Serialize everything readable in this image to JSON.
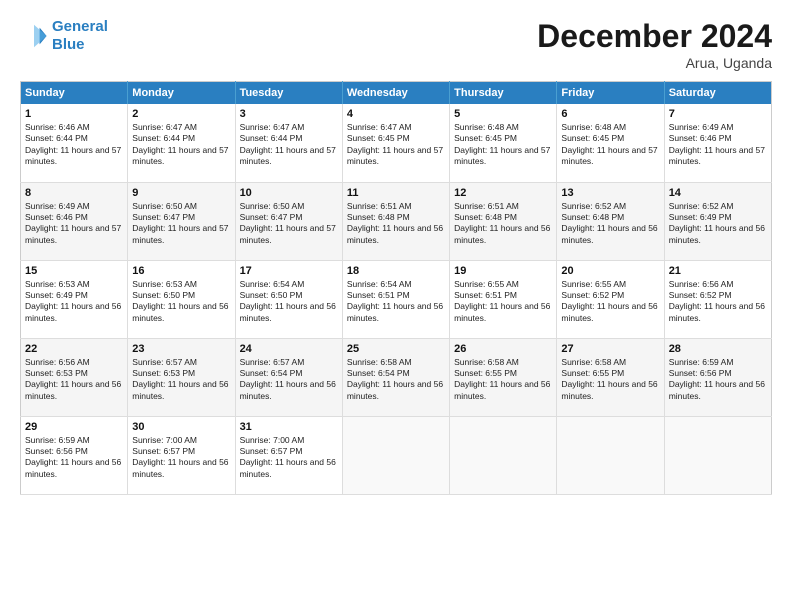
{
  "header": {
    "logo_line1": "General",
    "logo_line2": "Blue",
    "title": "December 2024",
    "location": "Arua, Uganda"
  },
  "weekdays": [
    "Sunday",
    "Monday",
    "Tuesday",
    "Wednesday",
    "Thursday",
    "Friday",
    "Saturday"
  ],
  "weeks": [
    [
      {
        "day": "1",
        "sunrise": "6:46 AM",
        "sunset": "6:44 PM",
        "daylight": "11 hours and 57 minutes."
      },
      {
        "day": "2",
        "sunrise": "6:47 AM",
        "sunset": "6:44 PM",
        "daylight": "11 hours and 57 minutes."
      },
      {
        "day": "3",
        "sunrise": "6:47 AM",
        "sunset": "6:44 PM",
        "daylight": "11 hours and 57 minutes."
      },
      {
        "day": "4",
        "sunrise": "6:47 AM",
        "sunset": "6:45 PM",
        "daylight": "11 hours and 57 minutes."
      },
      {
        "day": "5",
        "sunrise": "6:48 AM",
        "sunset": "6:45 PM",
        "daylight": "11 hours and 57 minutes."
      },
      {
        "day": "6",
        "sunrise": "6:48 AM",
        "sunset": "6:45 PM",
        "daylight": "11 hours and 57 minutes."
      },
      {
        "day": "7",
        "sunrise": "6:49 AM",
        "sunset": "6:46 PM",
        "daylight": "11 hours and 57 minutes."
      }
    ],
    [
      {
        "day": "8",
        "sunrise": "6:49 AM",
        "sunset": "6:46 PM",
        "daylight": "11 hours and 57 minutes."
      },
      {
        "day": "9",
        "sunrise": "6:50 AM",
        "sunset": "6:47 PM",
        "daylight": "11 hours and 57 minutes."
      },
      {
        "day": "10",
        "sunrise": "6:50 AM",
        "sunset": "6:47 PM",
        "daylight": "11 hours and 57 minutes."
      },
      {
        "day": "11",
        "sunrise": "6:51 AM",
        "sunset": "6:48 PM",
        "daylight": "11 hours and 56 minutes."
      },
      {
        "day": "12",
        "sunrise": "6:51 AM",
        "sunset": "6:48 PM",
        "daylight": "11 hours and 56 minutes."
      },
      {
        "day": "13",
        "sunrise": "6:52 AM",
        "sunset": "6:48 PM",
        "daylight": "11 hours and 56 minutes."
      },
      {
        "day": "14",
        "sunrise": "6:52 AM",
        "sunset": "6:49 PM",
        "daylight": "11 hours and 56 minutes."
      }
    ],
    [
      {
        "day": "15",
        "sunrise": "6:53 AM",
        "sunset": "6:49 PM",
        "daylight": "11 hours and 56 minutes."
      },
      {
        "day": "16",
        "sunrise": "6:53 AM",
        "sunset": "6:50 PM",
        "daylight": "11 hours and 56 minutes."
      },
      {
        "day": "17",
        "sunrise": "6:54 AM",
        "sunset": "6:50 PM",
        "daylight": "11 hours and 56 minutes."
      },
      {
        "day": "18",
        "sunrise": "6:54 AM",
        "sunset": "6:51 PM",
        "daylight": "11 hours and 56 minutes."
      },
      {
        "day": "19",
        "sunrise": "6:55 AM",
        "sunset": "6:51 PM",
        "daylight": "11 hours and 56 minutes."
      },
      {
        "day": "20",
        "sunrise": "6:55 AM",
        "sunset": "6:52 PM",
        "daylight": "11 hours and 56 minutes."
      },
      {
        "day": "21",
        "sunrise": "6:56 AM",
        "sunset": "6:52 PM",
        "daylight": "11 hours and 56 minutes."
      }
    ],
    [
      {
        "day": "22",
        "sunrise": "6:56 AM",
        "sunset": "6:53 PM",
        "daylight": "11 hours and 56 minutes."
      },
      {
        "day": "23",
        "sunrise": "6:57 AM",
        "sunset": "6:53 PM",
        "daylight": "11 hours and 56 minutes."
      },
      {
        "day": "24",
        "sunrise": "6:57 AM",
        "sunset": "6:54 PM",
        "daylight": "11 hours and 56 minutes."
      },
      {
        "day": "25",
        "sunrise": "6:58 AM",
        "sunset": "6:54 PM",
        "daylight": "11 hours and 56 minutes."
      },
      {
        "day": "26",
        "sunrise": "6:58 AM",
        "sunset": "6:55 PM",
        "daylight": "11 hours and 56 minutes."
      },
      {
        "day": "27",
        "sunrise": "6:58 AM",
        "sunset": "6:55 PM",
        "daylight": "11 hours and 56 minutes."
      },
      {
        "day": "28",
        "sunrise": "6:59 AM",
        "sunset": "6:56 PM",
        "daylight": "11 hours and 56 minutes."
      }
    ],
    [
      {
        "day": "29",
        "sunrise": "6:59 AM",
        "sunset": "6:56 PM",
        "daylight": "11 hours and 56 minutes."
      },
      {
        "day": "30",
        "sunrise": "7:00 AM",
        "sunset": "6:57 PM",
        "daylight": "11 hours and 56 minutes."
      },
      {
        "day": "31",
        "sunrise": "7:00 AM",
        "sunset": "6:57 PM",
        "daylight": "11 hours and 56 minutes."
      },
      null,
      null,
      null,
      null
    ]
  ]
}
